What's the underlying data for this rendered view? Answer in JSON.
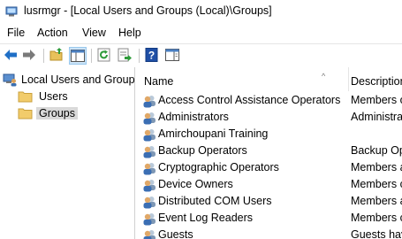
{
  "window": {
    "title": "lusrmgr - [Local Users and Groups (Local)\\Groups]"
  },
  "menu": [
    "File",
    "Action",
    "View",
    "Help"
  ],
  "toolbar": {
    "buttons": [
      "back-arrow-icon",
      "forward-arrow-icon",
      "up-folder-icon",
      "show-hide-tree-icon",
      "refresh-icon",
      "export-list-icon",
      "help-icon",
      "properties-panel-icon"
    ]
  },
  "tree": {
    "root": "Local Users and Groups",
    "children": [
      "Users",
      "Groups"
    ],
    "selected": "Groups"
  },
  "list": {
    "columns": [
      "Name",
      "Description"
    ],
    "rows": [
      {
        "name": "Access Control Assistance Operators",
        "description": "Members of"
      },
      {
        "name": "Administrators",
        "description": "Administrat"
      },
      {
        "name": "Amirchoupani Training",
        "description": ""
      },
      {
        "name": "Backup Operators",
        "description": "Backup Op"
      },
      {
        "name": "Cryptographic Operators",
        "description": "Members a"
      },
      {
        "name": "Device Owners",
        "description": "Members c"
      },
      {
        "name": "Distributed COM Users",
        "description": "Members a"
      },
      {
        "name": "Event Log Readers",
        "description": "Members c"
      },
      {
        "name": "Guests",
        "description": "Guests hav"
      }
    ]
  },
  "colors": {
    "accent": "#0078d7",
    "selection": "#d9d9d9",
    "folder": "#f2cc6b"
  }
}
